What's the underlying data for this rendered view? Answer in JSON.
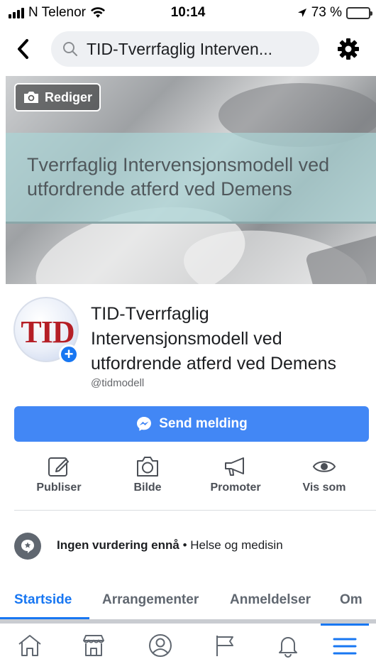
{
  "status_bar": {
    "carrier": "N Telenor",
    "time": "10:14",
    "battery_percent": "73 %",
    "battery_level": 0.73
  },
  "nav": {
    "back_icon": "chevron-left-icon",
    "search_text": "TID-Tverrfaglig Interven...",
    "settings_icon": "gear-icon"
  },
  "cover": {
    "edit_label": "Rediger",
    "banner_text": "Tverrfaglig Intervensjonsmodell ved utfordrende atferd ved Demens"
  },
  "profile": {
    "avatar_text": "TID",
    "name": "TID-Tverrfaglig Intervensjonsmodell ved utfordrende atferd ved Demens",
    "handle": "@tidmodell"
  },
  "primary_action": {
    "label": "Send melding",
    "color": "#4287f5"
  },
  "actions": [
    {
      "label": "Publiser",
      "icon": "compose-icon"
    },
    {
      "label": "Bilde",
      "icon": "camera-icon"
    },
    {
      "label": "Promoter",
      "icon": "megaphone-icon"
    },
    {
      "label": "Vis som",
      "icon": "eye-icon"
    }
  ],
  "info": {
    "review_bold": "Ingen vurdering ennå",
    "review_rest": " • Helse og medisin"
  },
  "tabs": [
    {
      "label": "Startside",
      "active": true
    },
    {
      "label": "Arrangementer",
      "active": false
    },
    {
      "label": "Anmeldelser",
      "active": false
    },
    {
      "label": "Om",
      "active": false
    }
  ],
  "bottom_nav": [
    {
      "icon": "home-icon"
    },
    {
      "icon": "marketplace-icon"
    },
    {
      "icon": "profile-icon"
    },
    {
      "icon": "flag-icon"
    },
    {
      "icon": "bell-icon"
    },
    {
      "icon": "menu-icon",
      "active": true
    }
  ],
  "accent_color": "#1877f2"
}
